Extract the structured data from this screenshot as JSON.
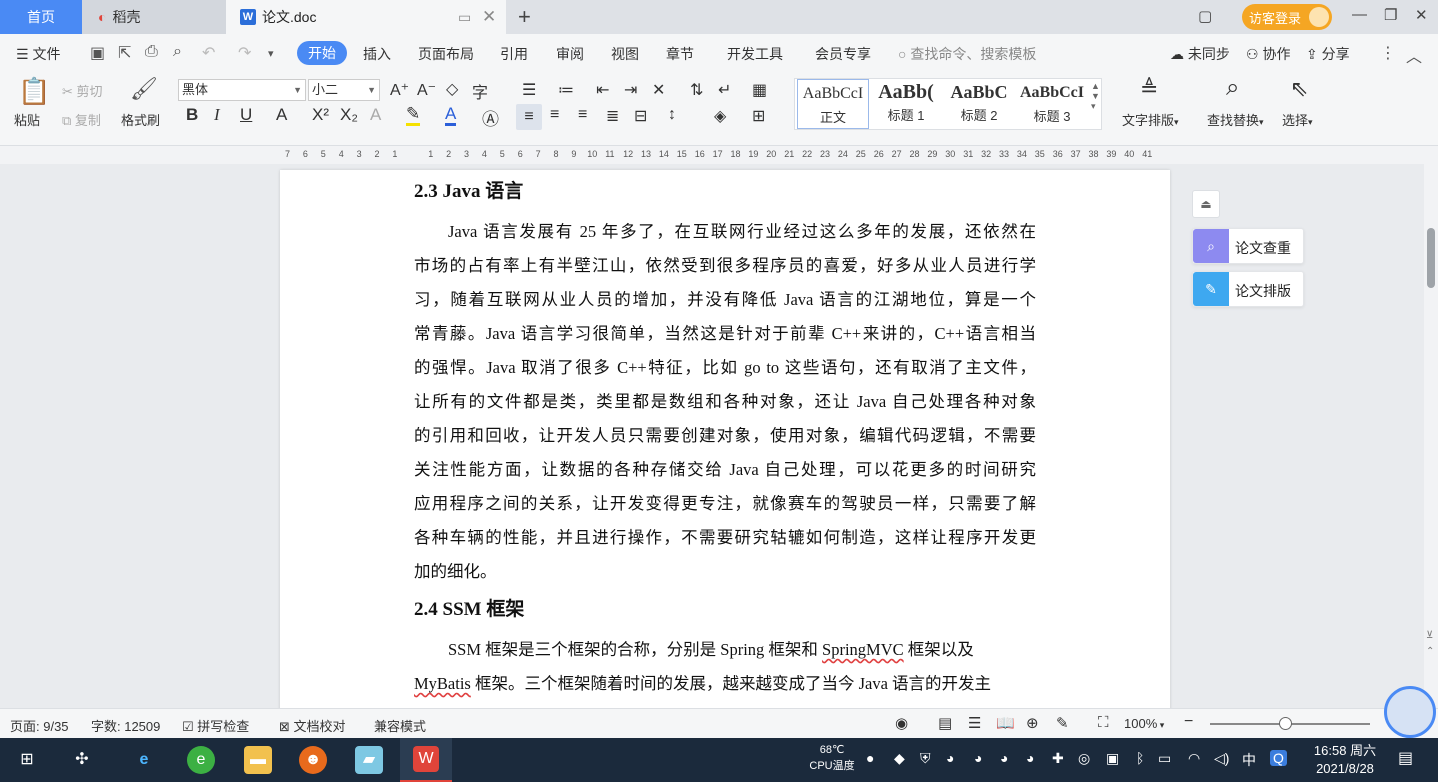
{
  "titlebar": {
    "tabs": [
      {
        "label": "首页"
      },
      {
        "label": "稻壳"
      },
      {
        "label": "论文.doc"
      }
    ],
    "login_label": "访客登录"
  },
  "menubar": {
    "file_label": "文件",
    "items": [
      "开始",
      "插入",
      "页面布局",
      "引用",
      "审阅",
      "视图",
      "章节",
      "开发工具",
      "会员专享"
    ],
    "search_placeholder": "查找命令、搜索模板",
    "sync_label": "未同步",
    "collab_label": "协作",
    "share_label": "分享"
  },
  "ribbon": {
    "paste_label": "粘贴",
    "cut_label": "剪切",
    "copy_label": "复制",
    "format_painter_label": "格式刷",
    "font_name": "黑体",
    "font_size": "小二",
    "styles": [
      {
        "preview": "AaBbCcI",
        "name": "正文"
      },
      {
        "preview": "AaBb(",
        "name": "标题 1"
      },
      {
        "preview": "AaBbC",
        "name": "标题 2"
      },
      {
        "preview": "AaBbCcI",
        "name": "标题 3"
      }
    ],
    "text_layout_label": "文字排版",
    "find_replace_label": "查找替换",
    "select_label": "选择"
  },
  "ruler": {
    "ticks": [
      "7",
      "6",
      "5",
      "4",
      "3",
      "2",
      "1",
      "",
      "1",
      "2",
      "3",
      "4",
      "5",
      "6",
      "7",
      "8",
      "9",
      "10",
      "11",
      "12",
      "13",
      "14",
      "15",
      "16",
      "17",
      "18",
      "19",
      "20",
      "21",
      "22",
      "23",
      "24",
      "25",
      "26",
      "27",
      "28",
      "29",
      "30",
      "31",
      "32",
      "33",
      "34",
      "35",
      "36",
      "37",
      "38",
      "39",
      "40",
      "41"
    ]
  },
  "document": {
    "heading1": "2.3 Java 语言",
    "para1": [
      "Java 语言发展有 25 年多了，在互联网行业经过这么多年的发展，还依然在",
      "市场的占有率上有半壁江山，依然受到很多程序员的喜爱，好多从业人员进行学",
      "习，随着互联网从业人员的增加，并没有降低 Java 语言的江湖地位，算是一个",
      "常青藤。Java 语言学习很简单，当然这是针对于前辈 C++来讲的，C++语言相当",
      "的强悍。Java 取消了很多 C++特征，比如 go to 这些语句，还有取消了主文件，",
      "让所有的文件都是类，类里都是数组和各种对象，还让 Java 自己处理各种对象",
      "的引用和回收，让开发人员只需要创建对象，使用对象，编辑代码逻辑，不需要",
      "关注性能方面，让数据的各种存储交给 Java 自己处理，可以花更多的时间研究",
      "应用程序之间的关系，让开发变得更专注，就像赛车的驾驶员一样，只需要了解",
      "各种车辆的性能，并且进行操作，不需要研究轱辘如何制造，这样让程序开发更",
      "加的细化。"
    ],
    "heading2": "2.4 SSM 框架",
    "para2_line1_a": "SSM 框架是三个框架的合称，分别是 Spring 框架和 ",
    "para2_line1_b": "SpringMVC",
    "para2_line1_c": " 框架以及",
    "para2_line2_a": "MyBatis",
    "para2_line2_b": " 框架。三个框架随着时间的发展，越来越变成了当今 Java 语言的开发主"
  },
  "side_panel": {
    "check_label": "论文查重",
    "format_label": "论文排版"
  },
  "statusbar": {
    "page": "页面: 9/35",
    "words": "字数: 12509",
    "spell": "拼写检查",
    "proof": "文档校对",
    "compat": "兼容模式",
    "zoom": "100%"
  },
  "taskbar": {
    "cpu_temp": "68℃",
    "cpu_label": "CPU温度",
    "ime": "中",
    "time": "16:58 周六",
    "date": "2021/8/28"
  },
  "colors": {
    "accent": "#4a8af4",
    "login": "#f5a623",
    "taskbar": "#1b2a3c"
  }
}
